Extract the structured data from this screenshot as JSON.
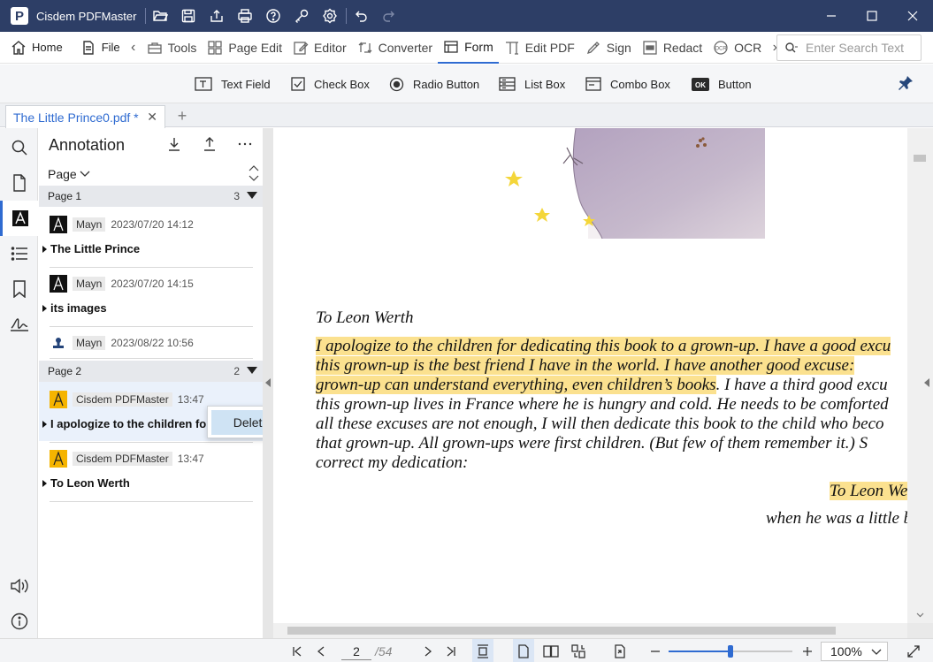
{
  "app": {
    "title": "Cisdem PDFMaster",
    "brand_color": "#2d3e66",
    "accent_color": "#2f6bd1"
  },
  "titlebar_icons": [
    "folder-open-icon",
    "save-icon",
    "share-icon",
    "print-icon",
    "help-icon",
    "key-icon",
    "settings-icon",
    "undo-icon",
    "redo-icon"
  ],
  "menu": {
    "home": "Home",
    "file": "File",
    "tools": "Tools",
    "page_edit": "Page Edit",
    "editor": "Editor",
    "converter": "Converter",
    "form": "Form",
    "edit_pdf": "Edit PDF",
    "sign": "Sign",
    "redact": "Redact",
    "ocr": "OCR",
    "search_placeholder": "Enter Search Text"
  },
  "form_toolbar": {
    "text_field": "Text Field",
    "check_box": "Check Box",
    "radio_button": "Radio Button",
    "list_box": "List Box",
    "combo_box": "Combo Box",
    "button": "Button",
    "button_icon_text": "OK"
  },
  "tab": {
    "name": "The Little Prince0.pdf *",
    "close": "✕",
    "add": "+"
  },
  "panel": {
    "title": "Annotation",
    "page_filter": "Page",
    "groups": [
      {
        "title": "Page 1",
        "count": "3",
        "items": [
          {
            "author": "Mayn",
            "time": "2023/07/20 14:12",
            "text": "The Little Prince",
            "icon": "text-annotation-icon"
          },
          {
            "author": "Mayn",
            "time": "2023/07/20 14:15",
            "text": "its images",
            "icon": "text-annotation-icon"
          },
          {
            "author": "Mayn",
            "time": "2023/08/22 10:56",
            "text": "",
            "icon": "stamp-annotation-icon"
          }
        ]
      },
      {
        "title": "Page 2",
        "count": "2",
        "items": [
          {
            "author": "Cisdem PDFMaster",
            "time": "13:47",
            "text": "I apologize to the children fo",
            "icon": "highlight-annotation-icon"
          },
          {
            "author": "Cisdem PDFMaster",
            "time": "13:47",
            "text": "To Leon Werth",
            "icon": "highlight-annotation-icon"
          }
        ]
      }
    ],
    "context_menu": {
      "delete": "Delete"
    }
  },
  "document": {
    "heading": "To Leon Werth",
    "lines": [
      {
        "hl": "I apologize to the children for dedicating this book to a grown-up. I have a good excu",
        "rest": ""
      },
      {
        "hl": "this grown-up is the best friend I have in the world. I have another good excuse: ",
        "rest": ""
      },
      {
        "hl": "grown-up can understand everything, even children’s books",
        "rest": ". I have a third good excu"
      },
      {
        "hl": "",
        "rest": "this grown-up lives in France where he is hungry and cold. He needs to be comforted"
      },
      {
        "hl": "",
        "rest": "all these excuses are not enough, I will then dedicate this book to the child who beco"
      },
      {
        "hl": "",
        "rest": "that grown-up. All grown-ups were first children. (But few of them remember it.) S"
      },
      {
        "hl": "",
        "rest": "correct my dedication:"
      }
    ],
    "signature": "To Leon We",
    "signature_sub": "when he was a little b",
    "highlight_color": "#fbe18f"
  },
  "status": {
    "current_page": "2",
    "total_pages": "/54",
    "zoom": "100%",
    "zoom_level": 0.5
  }
}
